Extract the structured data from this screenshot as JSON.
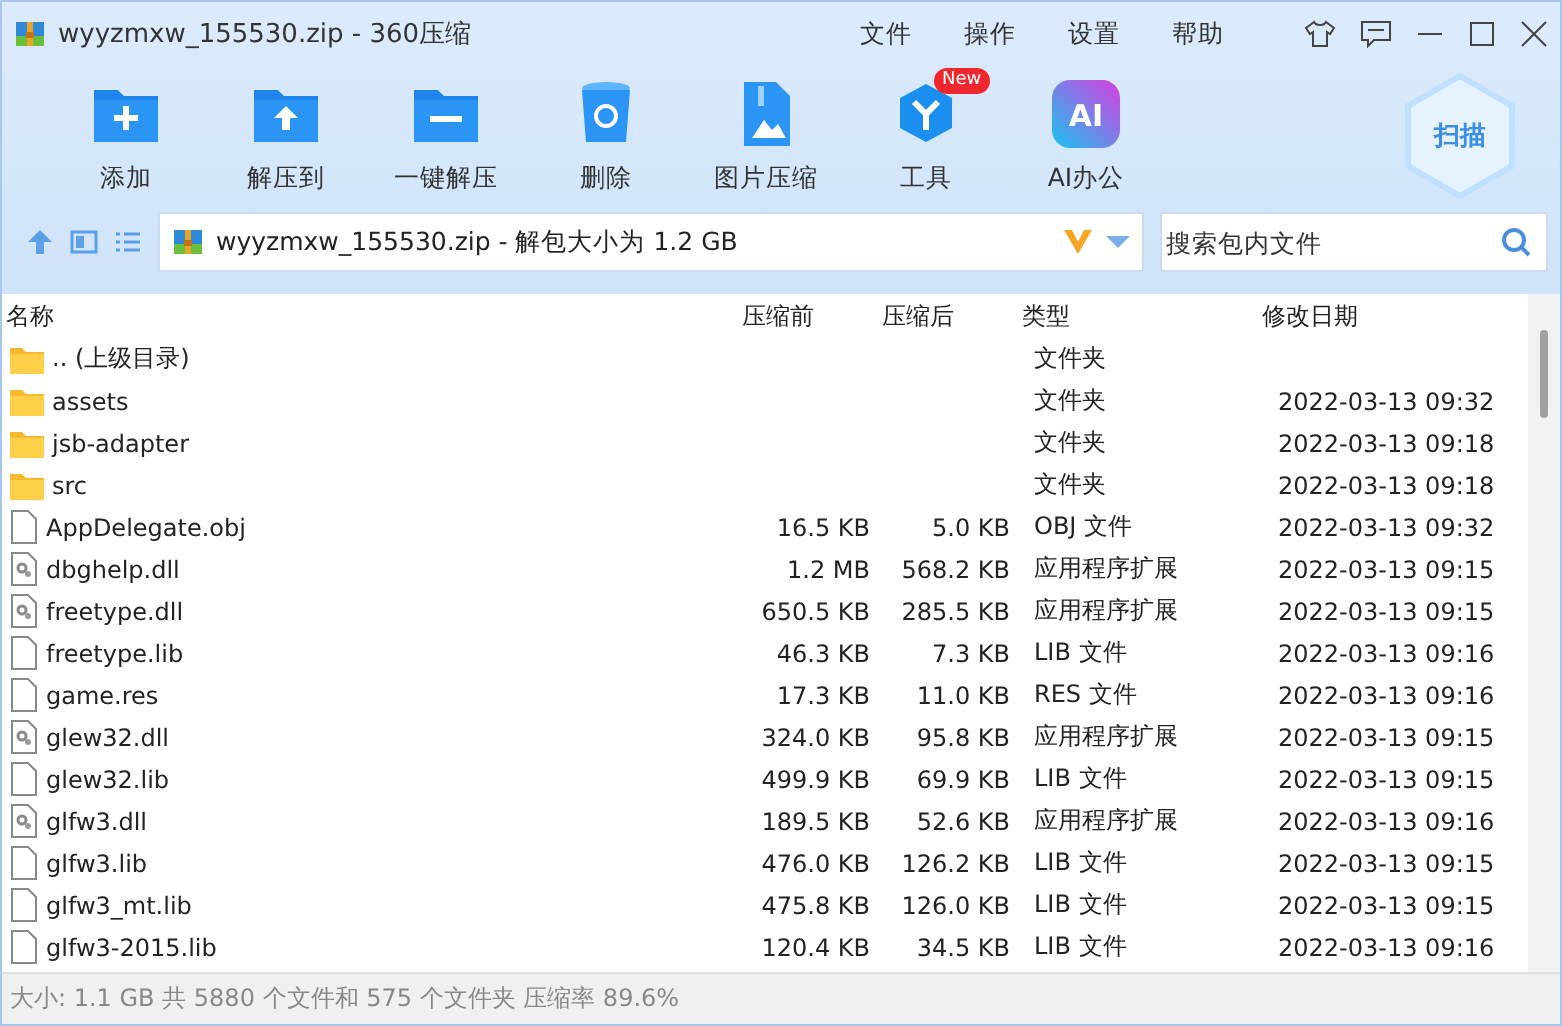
{
  "window": {
    "title": "wyyzmxw_155530.zip - 360压缩"
  },
  "menu": [
    "文件",
    "操作",
    "设置",
    "帮助"
  ],
  "toolbar": [
    {
      "kind": "add",
      "label": "添加"
    },
    {
      "kind": "extract",
      "label": "解压到"
    },
    {
      "kind": "onekey",
      "label": "一键解压"
    },
    {
      "kind": "delete",
      "label": "删除"
    },
    {
      "kind": "image",
      "label": "图片压缩"
    },
    {
      "kind": "tools",
      "label": "工具",
      "badge": "New"
    },
    {
      "kind": "ai",
      "label": "AI办公",
      "icon_text": "AI"
    }
  ],
  "scan_button": "扫描",
  "address": {
    "path": "wyyzmxw_155530.zip - 解包大小为 1.2 GB"
  },
  "search": {
    "placeholder": "搜索包内文件"
  },
  "table": {
    "columns": [
      "名称",
      "压缩前",
      "压缩后",
      "类型",
      "修改日期"
    ],
    "rows": [
      {
        "kind": "folder",
        "name": ".. (上级目录)",
        "size": "",
        "packed": "",
        "type": "文件夹",
        "modified": ""
      },
      {
        "kind": "folder",
        "name": "assets",
        "size": "",
        "packed": "",
        "type": "文件夹",
        "modified": "2022-03-13 09:32"
      },
      {
        "kind": "folder",
        "name": "jsb-adapter",
        "size": "",
        "packed": "",
        "type": "文件夹",
        "modified": "2022-03-13 09:18"
      },
      {
        "kind": "folder",
        "name": "src",
        "size": "",
        "packed": "",
        "type": "文件夹",
        "modified": "2022-03-13 09:18"
      },
      {
        "kind": "file",
        "name": "AppDelegate.obj",
        "size": "16.5 KB",
        "packed": "5.0 KB",
        "type": "OBJ 文件",
        "modified": "2022-03-13 09:32"
      },
      {
        "kind": "dll",
        "name": "dbghelp.dll",
        "size": "1.2 MB",
        "packed": "568.2 KB",
        "type": "应用程序扩展",
        "modified": "2022-03-13 09:15"
      },
      {
        "kind": "dll",
        "name": "freetype.dll",
        "size": "650.5 KB",
        "packed": "285.5 KB",
        "type": "应用程序扩展",
        "modified": "2022-03-13 09:15"
      },
      {
        "kind": "file",
        "name": "freetype.lib",
        "size": "46.3 KB",
        "packed": "7.3 KB",
        "type": "LIB 文件",
        "modified": "2022-03-13 09:16"
      },
      {
        "kind": "file",
        "name": "game.res",
        "size": "17.3 KB",
        "packed": "11.0 KB",
        "type": "RES 文件",
        "modified": "2022-03-13 09:16"
      },
      {
        "kind": "dll",
        "name": "glew32.dll",
        "size": "324.0 KB",
        "packed": "95.8 KB",
        "type": "应用程序扩展",
        "modified": "2022-03-13 09:15"
      },
      {
        "kind": "file",
        "name": "glew32.lib",
        "size": "499.9 KB",
        "packed": "69.9 KB",
        "type": "LIB 文件",
        "modified": "2022-03-13 09:15"
      },
      {
        "kind": "dll",
        "name": "glfw3.dll",
        "size": "189.5 KB",
        "packed": "52.6 KB",
        "type": "应用程序扩展",
        "modified": "2022-03-13 09:16"
      },
      {
        "kind": "file",
        "name": "glfw3.lib",
        "size": "476.0 KB",
        "packed": "126.2 KB",
        "type": "LIB 文件",
        "modified": "2022-03-13 09:15"
      },
      {
        "kind": "file",
        "name": "glfw3_mt.lib",
        "size": "475.8 KB",
        "packed": "126.0 KB",
        "type": "LIB 文件",
        "modified": "2022-03-13 09:15"
      },
      {
        "kind": "file",
        "name": "glfw3-2015.lib",
        "size": "120.4 KB",
        "packed": "34.5 KB",
        "type": "LIB 文件",
        "modified": "2022-03-13 09:16"
      }
    ]
  },
  "status_bar": "大小: 1.1 GB 共 5880 个文件和 575 个文件夹 压缩率 89.6%"
}
